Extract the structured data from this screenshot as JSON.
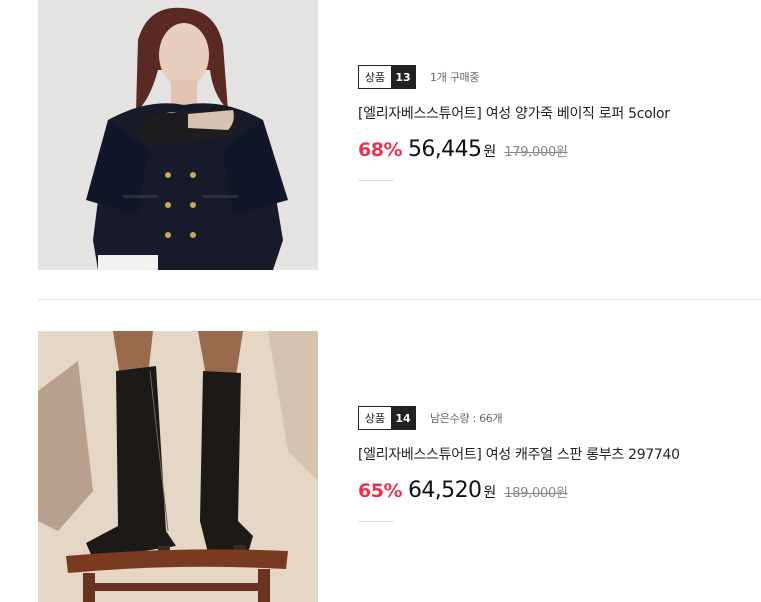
{
  "products": [
    {
      "badge_label": "상품",
      "badge_number": "13",
      "status": "1개 구매중",
      "title": "[엘리자베스스튜어트] 여성 양가죽 베이직 로퍼 5color",
      "discount": "68%",
      "price": "56,445",
      "currency": "원",
      "original_price": "179,000원",
      "image_icon": "model-holding-loafer-photo"
    },
    {
      "badge_label": "상품",
      "badge_number": "14",
      "status": "남은수량 : 66개",
      "title": "[엘리자베스스튜어트] 여성 캐주얼 스판 롱부츠 297740",
      "discount": "65%",
      "price": "64,520",
      "currency": "원",
      "original_price": "189,000원",
      "image_icon": "long-boots-on-stool-photo"
    }
  ],
  "colors": {
    "discount": "#e8344e",
    "badge_dark": "#222222"
  }
}
